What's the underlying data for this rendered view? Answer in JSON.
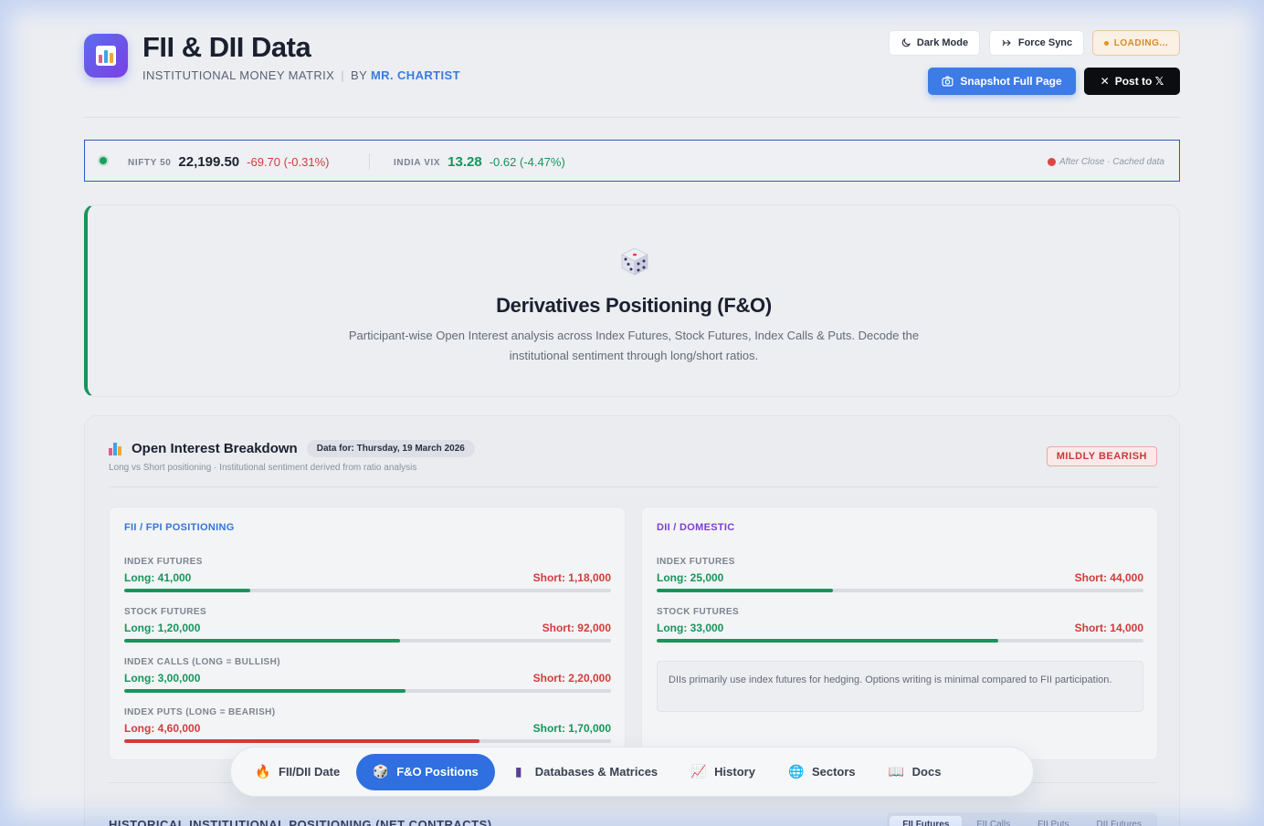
{
  "app": {
    "title": "FII & DII Data",
    "subtitle": "INSTITUTIONAL MONEY MATRIX",
    "by": "BY",
    "author": "MR. CHARTIST"
  },
  "toolbar": {
    "dark_mode": "Dark Mode",
    "force_sync": "Force Sync",
    "loading": "LOADING...",
    "snapshot": "Snapshot Full Page",
    "post_to_x": "Post to 𝕏"
  },
  "ticker": {
    "nifty_label": "NIFTY 50",
    "nifty_value": "22,199.50",
    "nifty_change": "-69.70 (-0.31%)",
    "vix_label": "INDIA VIX",
    "vix_value": "13.28",
    "vix_change": "-0.62 (-4.47%)",
    "status": "After Close · Cached data"
  },
  "hero": {
    "title": "Derivatives Positioning (F&O)",
    "description": "Participant-wise Open Interest analysis across Index Futures, Stock Futures, Index Calls & Puts. Decode the institutional sentiment through long/short ratios."
  },
  "oi": {
    "title": "Open Interest Breakdown",
    "date_chip": "Data for: Thursday, 19 March 2026",
    "subtitle": "Long vs Short positioning · Institutional sentiment derived from ratio analysis",
    "sentiment": "MILDLY BEARISH",
    "fii": {
      "title": "FII / FPI POSITIONING",
      "rows": [
        {
          "label": "INDEX FUTURES",
          "long": "Long: 41,000",
          "short": "Short: 1,18,000",
          "long_share": 0.258
        },
        {
          "label": "STOCK FUTURES",
          "long": "Long: 1,20,000",
          "short": "Short: 92,000",
          "long_share": 0.566
        },
        {
          "label": "INDEX CALLS (LONG = BULLISH)",
          "long": "Long: 3,00,000",
          "short": "Short: 2,20,000",
          "long_share": 0.577
        },
        {
          "label": "INDEX PUTS (LONG = BEARISH)",
          "long": "Long: 4,60,000",
          "short": "Short: 1,70,000",
          "long_share": 0.73
        }
      ]
    },
    "dii": {
      "title": "DII / DOMESTIC",
      "rows": [
        {
          "label": "INDEX FUTURES",
          "long": "Long: 25,000",
          "short": "Short: 44,000",
          "long_share": 0.362
        },
        {
          "label": "STOCK FUTURES",
          "long": "Long: 33,000",
          "short": "Short: 14,000",
          "long_share": 0.702
        }
      ],
      "note": "DIIs primarily use index futures for hedging. Options writing is minimal compared to FII participation."
    }
  },
  "history": {
    "title": "HISTORICAL INSTITUTIONAL POSITIONING (NET CONTRACTS)",
    "tabs": [
      "FII Futures",
      "FII Calls",
      "FII Puts",
      "DII Futures"
    ]
  },
  "nav": {
    "items": [
      {
        "label": "FII/DII Date",
        "icon": "fire-icon",
        "glyph": "🔥"
      },
      {
        "label": "F&O Positions",
        "icon": "dice-icon",
        "glyph": "🎲"
      },
      {
        "label": "Databases & Matrices",
        "icon": "database-icon",
        "glyph": "▮"
      },
      {
        "label": "History",
        "icon": "chart-icon",
        "glyph": "📈"
      },
      {
        "label": "Sectors",
        "icon": "globe-icon",
        "glyph": "🌐"
      },
      {
        "label": "Docs",
        "icon": "book-icon",
        "glyph": "📖"
      }
    ],
    "active_index": 1
  },
  "colors": {
    "accent_blue": "#2f6fe0",
    "bull_green": "#15965a",
    "bear_red": "#d23b3b",
    "dii_purple": "#7a3fd2"
  }
}
